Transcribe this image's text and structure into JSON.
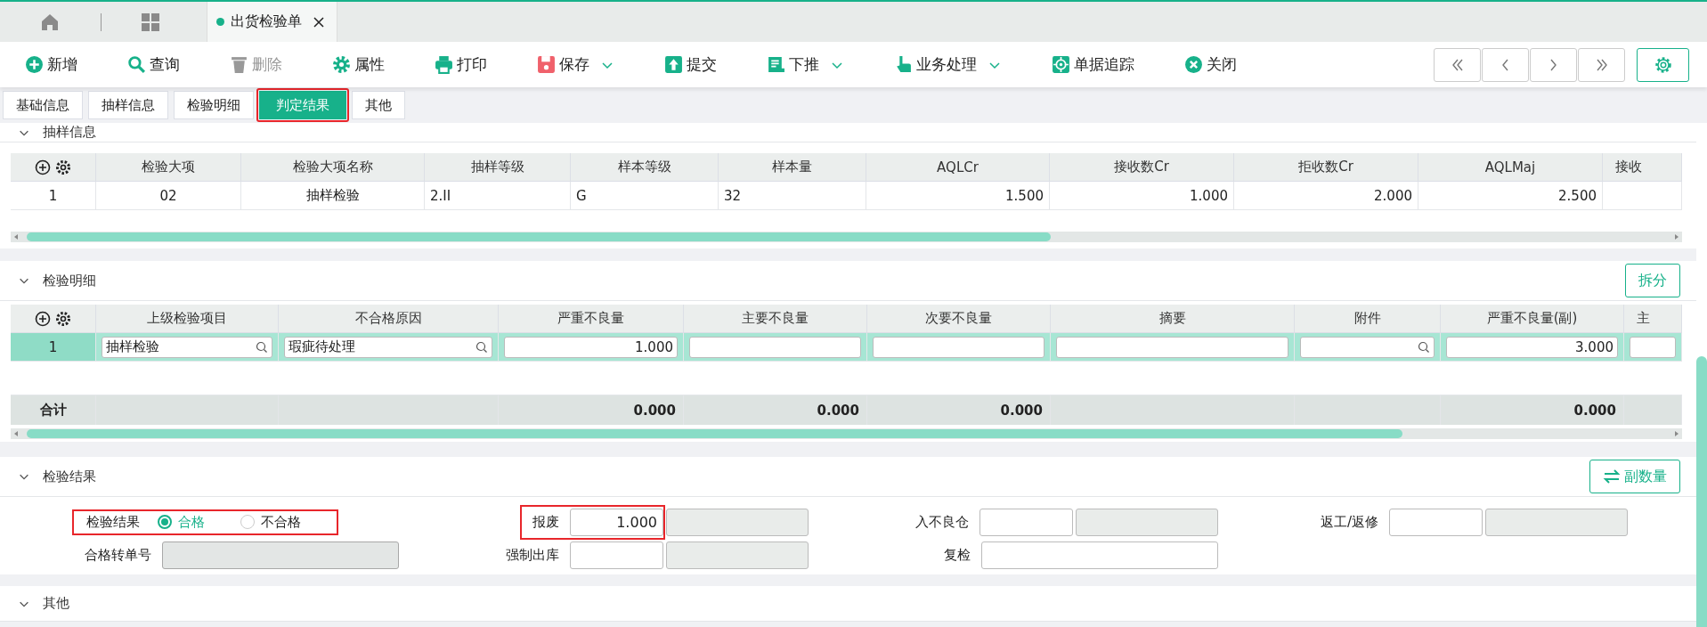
{
  "doc_tab": {
    "title": "出货检验单",
    "selected": true
  },
  "toolbar": [
    {
      "label": "新增",
      "disabled": false,
      "dropdown": false
    },
    {
      "label": "查询",
      "disabled": false,
      "dropdown": false
    },
    {
      "label": "删除",
      "disabled": true,
      "dropdown": false
    },
    {
      "label": "属性",
      "disabled": false,
      "dropdown": false
    },
    {
      "label": "打印",
      "disabled": false,
      "dropdown": false
    },
    {
      "label": "保存",
      "disabled": false,
      "dropdown": true
    },
    {
      "label": "提交",
      "disabled": false,
      "dropdown": false
    },
    {
      "label": "下推",
      "disabled": false,
      "dropdown": true
    },
    {
      "label": "业务处理",
      "disabled": false,
      "dropdown": true
    },
    {
      "label": "单据追踪",
      "disabled": false,
      "dropdown": false
    },
    {
      "label": "关闭",
      "disabled": false,
      "dropdown": false
    }
  ],
  "subtabs": [
    {
      "label": "基础信息",
      "selected": false,
      "highlighted": false
    },
    {
      "label": "抽样信息",
      "selected": false,
      "highlighted": false
    },
    {
      "label": "检验明细",
      "selected": false,
      "highlighted": false
    },
    {
      "label": "判定结果",
      "selected": true,
      "highlighted": true
    },
    {
      "label": "其他",
      "selected": false,
      "highlighted": false
    }
  ],
  "sampling": {
    "title": "抽样信息",
    "columns": [
      {
        "title": "检验大项",
        "kind": "center"
      },
      {
        "title": "检验大项名称",
        "kind": "center"
      },
      {
        "title": "抽样等级",
        "kind": "text"
      },
      {
        "title": "样本等级",
        "kind": "text"
      },
      {
        "title": "样本量",
        "kind": "text"
      },
      {
        "title": "AQLCr",
        "kind": "number"
      },
      {
        "title": "接收数Cr",
        "kind": "number"
      },
      {
        "title": "拒收数Cr",
        "kind": "number"
      },
      {
        "title": "AQLMaj",
        "kind": "number"
      },
      {
        "title": "接收",
        "kind": "number"
      }
    ],
    "rows": [
      {
        "number": "1",
        "selected": false,
        "cells": [
          "02",
          "抽样检验",
          "2.II",
          "G",
          "32",
          "1.500",
          "1.000",
          "2.000",
          "2.500"
        ]
      }
    ]
  },
  "details": {
    "title": "检验明细",
    "button": "拆分",
    "total_label": "合计",
    "columns": [
      {
        "title": "上级检验项目"
      },
      {
        "title": "不合格原因"
      },
      {
        "title": "严重不良量",
        "total": "0.000"
      },
      {
        "title": "主要不良量",
        "total": "0.000"
      },
      {
        "title": "次要不良量",
        "total": "0.000"
      },
      {
        "title": "摘要"
      },
      {
        "title": "附件"
      },
      {
        "title": "严重不良量(副)",
        "total": "0.000"
      },
      {
        "title": "主"
      }
    ],
    "rows": [
      {
        "number": "1",
        "selected": true,
        "cells": [
          {
            "kind": "lookup",
            "value": "抽样检验"
          },
          {
            "kind": "lookup",
            "value": "瑕疵待处理"
          },
          {
            "kind": "input",
            "value": "1.000"
          },
          {
            "kind": "input"
          },
          {
            "kind": "input"
          },
          {
            "kind": "input"
          },
          {
            "kind": "lookup"
          },
          {
            "kind": "input",
            "value": "3.000"
          },
          {
            "kind": "input"
          }
        ]
      }
    ]
  },
  "result": {
    "title": "检验结果",
    "button": "副数量",
    "fields": [
      {
        "kind": "radio",
        "label": "检验结果",
        "highlighted": true,
        "options": [
          {
            "label": "合格",
            "selected": true
          },
          {
            "label": "不合格",
            "selected": false
          }
        ]
      },
      {
        "kind": "pair",
        "label": "报废",
        "value": "1.000",
        "highlighted": true
      },
      {
        "kind": "pair",
        "label": "入不良仓",
        "highlighted": false
      },
      {
        "kind": "pair",
        "label": "返工/返修",
        "highlighted": false
      },
      {
        "kind": "single",
        "label": "合格转单号",
        "disabled": true
      },
      {
        "kind": "pair",
        "label": "强制出库",
        "highlighted": false
      },
      {
        "kind": "single",
        "label": "复检",
        "disabled": false
      }
    ]
  },
  "other": {
    "title": "其他"
  }
}
